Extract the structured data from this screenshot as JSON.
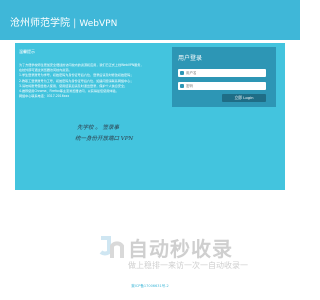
{
  "header": {
    "school_name": "沧州师范学院",
    "separator": "|",
    "product": "WebVPN"
  },
  "notice": {
    "title": "温馨提示",
    "paragraphs": [
      "为了方便学校师生更加安全便捷的访问校内的资源和应用，我们已正式上线WebVPN服务，",
      "在校外即可通过浏览器访问校内资源。",
      "1.学生登录账号为学号，初始密码为身份证号后六位，登录后请及时修改初始密码；",
      "2.教职工登录账号为工号，初始密码为身份证号后六位，如遇问题请联系网络中心；",
      "3.请勿将账号借给他人使用，使用结束后请及时退出登录，保护个人信息安全；",
      "4.推荐使用Chrome、Firefox等主流浏览器访问，以获得最佳使用体验。",
      "网络中心联系电话：0317-2016xxx"
    ]
  },
  "handwriting": {
    "line1": "先学校 。 签录事",
    "line2": "统一身份开放端口 VPN"
  },
  "login": {
    "title": "用户登录",
    "username_placeholder": "用户名",
    "password_placeholder": "密码",
    "submit_label": "立即 Login"
  },
  "watermark": {
    "title": "自动秒收录",
    "subtitle": "做上稳排一来访一次一自动收录一"
  },
  "footer": {
    "text": "冀ICP备17006631号-2"
  },
  "colors": {
    "header_bg": "#3fb7d8",
    "panel_bg": "#43c4de",
    "login_bg": "#2d96b5",
    "button_bg": "#1f6d86"
  }
}
